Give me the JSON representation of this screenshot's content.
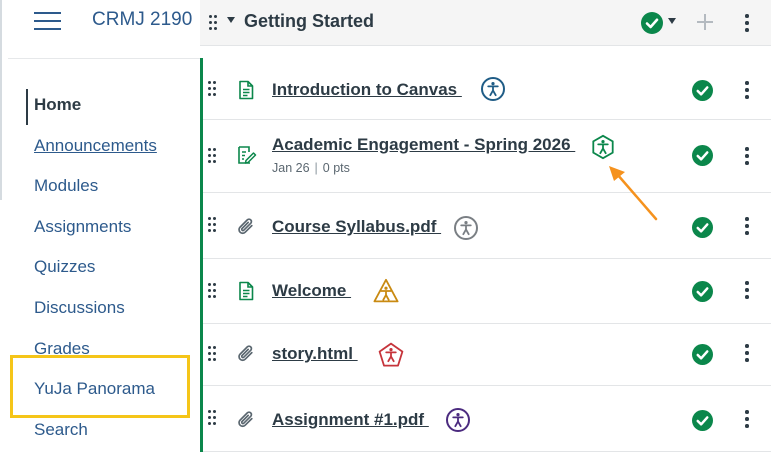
{
  "course": {
    "code": "CRMJ 2190"
  },
  "nav": {
    "items": [
      {
        "label": "Home",
        "active": true
      },
      {
        "label": "Announcements",
        "underlined": true
      },
      {
        "label": "Modules"
      },
      {
        "label": "Assignments"
      },
      {
        "label": "Quizzes"
      },
      {
        "label": "Discussions"
      },
      {
        "label": "Grades"
      },
      {
        "label": "YuJa Panorama",
        "highlighted": true
      },
      {
        "label": "Search"
      }
    ]
  },
  "module": {
    "title": "Getting Started",
    "published": true,
    "items": [
      {
        "title": "Introduction to Canvas ",
        "type_icon": "page-icon",
        "a11y_icon": "accessibility-circle-icon",
        "a11y_color": "#1f5c86"
      },
      {
        "title": "Academic Engagement - Spring 2026 ",
        "type_icon": "assignment-icon",
        "due": "Jan 26",
        "points": "0 pts",
        "a11y_icon": "accessibility-hexagon-icon",
        "a11y_color": "#0b874b"
      },
      {
        "title": "Course Syllabus.pdf ",
        "type_icon": "attachment-icon",
        "a11y_icon": "accessibility-circle-icon",
        "a11y_color": "#7a7f84"
      },
      {
        "title": "Welcome ",
        "type_icon": "page-icon",
        "a11y_icon": "accessibility-triangle-icon",
        "a11y_color": "#c98a12"
      },
      {
        "title": "story.html ",
        "type_icon": "attachment-icon",
        "a11y_icon": "accessibility-pentagon-icon",
        "a11y_color": "#c6343b"
      },
      {
        "title": "Assignment #1.pdf ",
        "type_icon": "attachment-icon",
        "a11y_icon": "accessibility-circle-icon",
        "a11y_color": "#4b2b7f"
      }
    ]
  },
  "colors": {
    "accent_link": "#2d5a8c",
    "published_green": "#0b874b",
    "highlight_box": "#f5c518",
    "annotation_arrow": "#f5921e"
  }
}
